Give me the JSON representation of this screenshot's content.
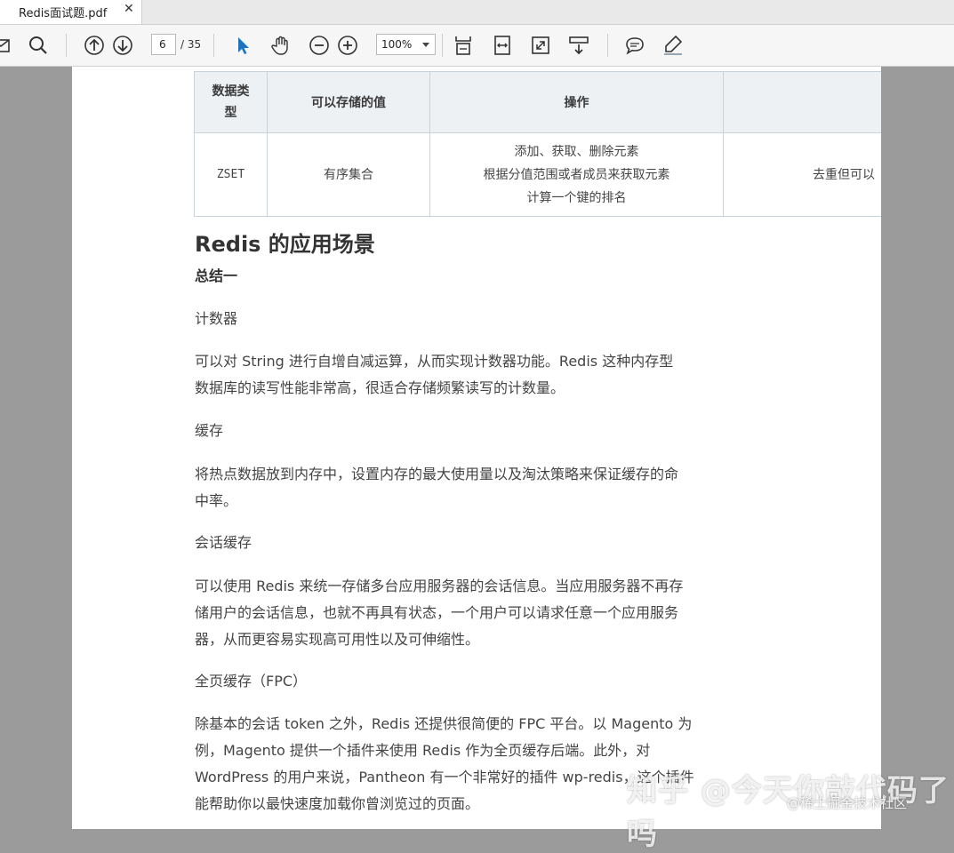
{
  "tab": {
    "title": "Redis面试题.pdf",
    "close": "✕"
  },
  "toolbar": {
    "page_current": "6",
    "page_total": "/ 35",
    "zoom": "100%"
  },
  "table": {
    "headers": [
      "数据类型",
      "可以存储的值",
      "操作",
      ""
    ],
    "row": {
      "type": "ZSET",
      "value": "有序集合",
      "ops": [
        "添加、获取、删除元素",
        "根据分值范围或者成员来获取元素",
        "计算一个键的排名"
      ],
      "use": "去重但可以"
    }
  },
  "content": {
    "heading": "Redis 的应用场景",
    "summary": "总结一",
    "p1_title": "计数器",
    "p1_l1": "可以对 String 进行自增自减运算，从而实现计数器功能。Redis 这种内存型",
    "p1_l2": "数据库的读写性能非常高，很适合存储频繁读写的计数量。",
    "p2_title": "缓存",
    "p2_l1": "将热点数据放到内存中，设置内存的最大使用量以及淘汰策略来保证缓存的命",
    "p2_l2": "中率。",
    "p3_title": "会话缓存",
    "p3_l1": "可以使用 Redis 来统一存储多台应用服务器的会话信息。当应用服务器不再存",
    "p3_l2": "储用户的会话信息，也就不再具有状态，一个用户可以请求任意一个应用服务",
    "p3_l3": "器，从而更容易实现高可用性以及可伸缩性。",
    "p4_title": "全页缓存（FPC）",
    "p4_l1": "除基本的会话 token 之外，Redis 还提供很简便的 FPC 平台。以 Magento 为",
    "p4_l2": "例，Magento 提供一个插件来使用 Redis 作为全页缓存后端。此外，对",
    "p4_l3": "WordPress 的用户来说，Pantheon 有一个非常好的插件 wp-redis，这个插件",
    "p4_l4": "能帮助你以最快速度加载你曾浏览过的页面。"
  },
  "watermark": {
    "main": "知乎 @今天你敲代码了吗",
    "sub": "@稀土掘金技术社区"
  },
  "colors": {
    "accent": "#1e73be",
    "page_bg": "#ffffff",
    "viewer_bg": "#9b9b9b"
  }
}
